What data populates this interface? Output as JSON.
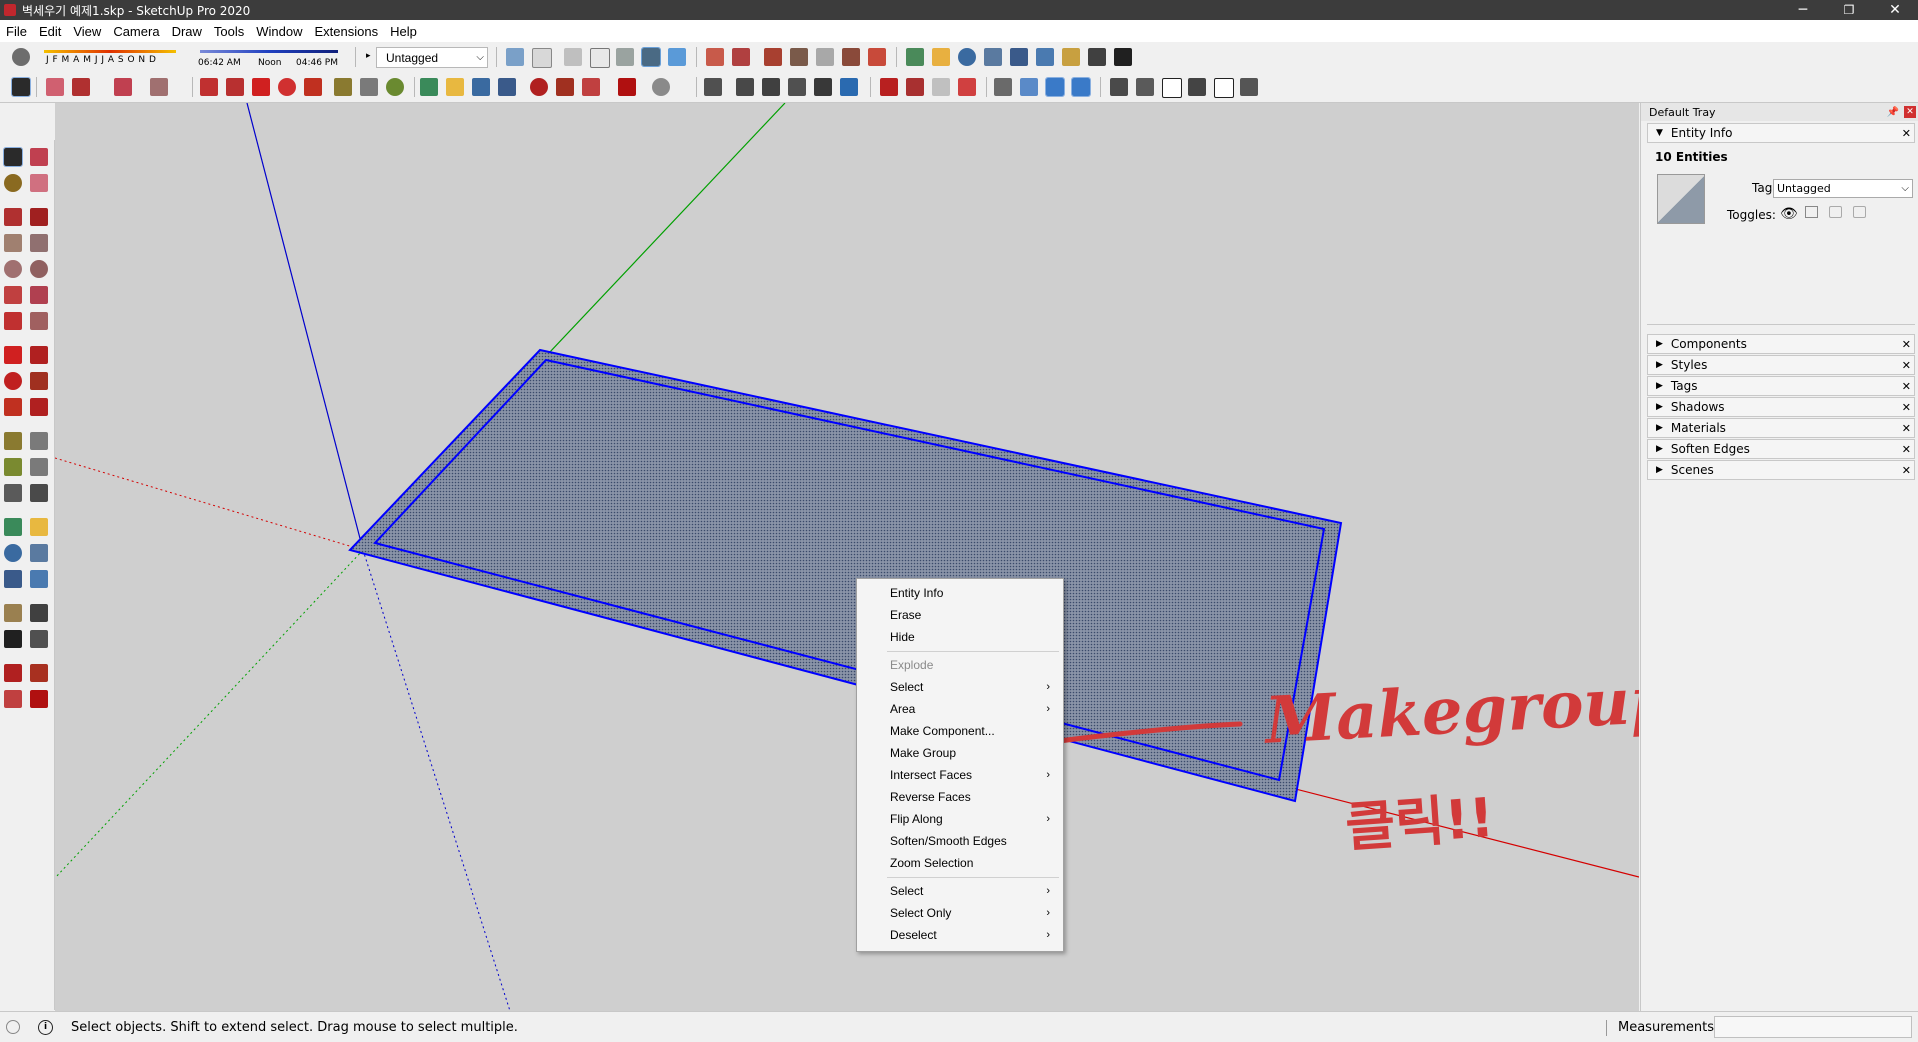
{
  "window": {
    "title": "벽세우기 예제1.skp - SketchUp Pro 2020",
    "minimize": "─",
    "restore": "❐",
    "close": "✕"
  },
  "menu": [
    "File",
    "Edit",
    "View",
    "Camera",
    "Draw",
    "Tools",
    "Window",
    "Extensions",
    "Help"
  ],
  "toolbar": {
    "months": "J F M A M J J A S O N D",
    "time_start": "06:42 AM",
    "time_noon": "Noon",
    "time_end": "04:46 PM",
    "tag_selected": "Untagged"
  },
  "tray": {
    "title": "Default Tray",
    "entity_info": {
      "header": "Entity Info",
      "count": "10 Entities",
      "tag_label": "Tag:",
      "tag_value": "Untagged",
      "toggles_label": "Toggles:"
    },
    "panels": [
      "Components",
      "Styles",
      "Tags",
      "Shadows",
      "Materials",
      "Soften Edges",
      "Scenes"
    ]
  },
  "context_menu": {
    "items": [
      {
        "label": "Entity Info",
        "disabled": false,
        "submenu": false
      },
      {
        "label": "Erase",
        "disabled": false,
        "submenu": false
      },
      {
        "label": "Hide",
        "disabled": false,
        "submenu": false
      },
      {
        "label": "Explode",
        "disabled": true,
        "submenu": false
      },
      {
        "label": "Select",
        "disabled": false,
        "submenu": true
      },
      {
        "label": "Area",
        "disabled": false,
        "submenu": true
      },
      {
        "label": "Make Component...",
        "disabled": false,
        "submenu": false
      },
      {
        "label": "Make Group",
        "disabled": false,
        "submenu": false
      },
      {
        "label": "Intersect Faces",
        "disabled": false,
        "submenu": true
      },
      {
        "label": "Reverse Faces",
        "disabled": false,
        "submenu": false
      },
      {
        "label": "Flip Along",
        "disabled": false,
        "submenu": true
      },
      {
        "label": "Soften/Smooth Edges",
        "disabled": false,
        "submenu": false
      },
      {
        "label": "Zoom Selection",
        "disabled": false,
        "submenu": false
      },
      {
        "label": "Select",
        "disabled": false,
        "submenu": true
      },
      {
        "label": "Select Only",
        "disabled": false,
        "submenu": true
      },
      {
        "label": "Deselect",
        "disabled": false,
        "submenu": true
      }
    ]
  },
  "annotation": {
    "line1": "Makegroup",
    "line2": "클릭!!",
    "color": "#d23a3a"
  },
  "status": {
    "message": "Select objects. Shift to extend select. Drag mouse to select multiple.",
    "measurements_label": "Measurements"
  },
  "colors": {
    "selection_blue": "#0000ff",
    "axis_red": "#d40000",
    "axis_green": "#00a000",
    "axis_blue": "#0000cc"
  }
}
